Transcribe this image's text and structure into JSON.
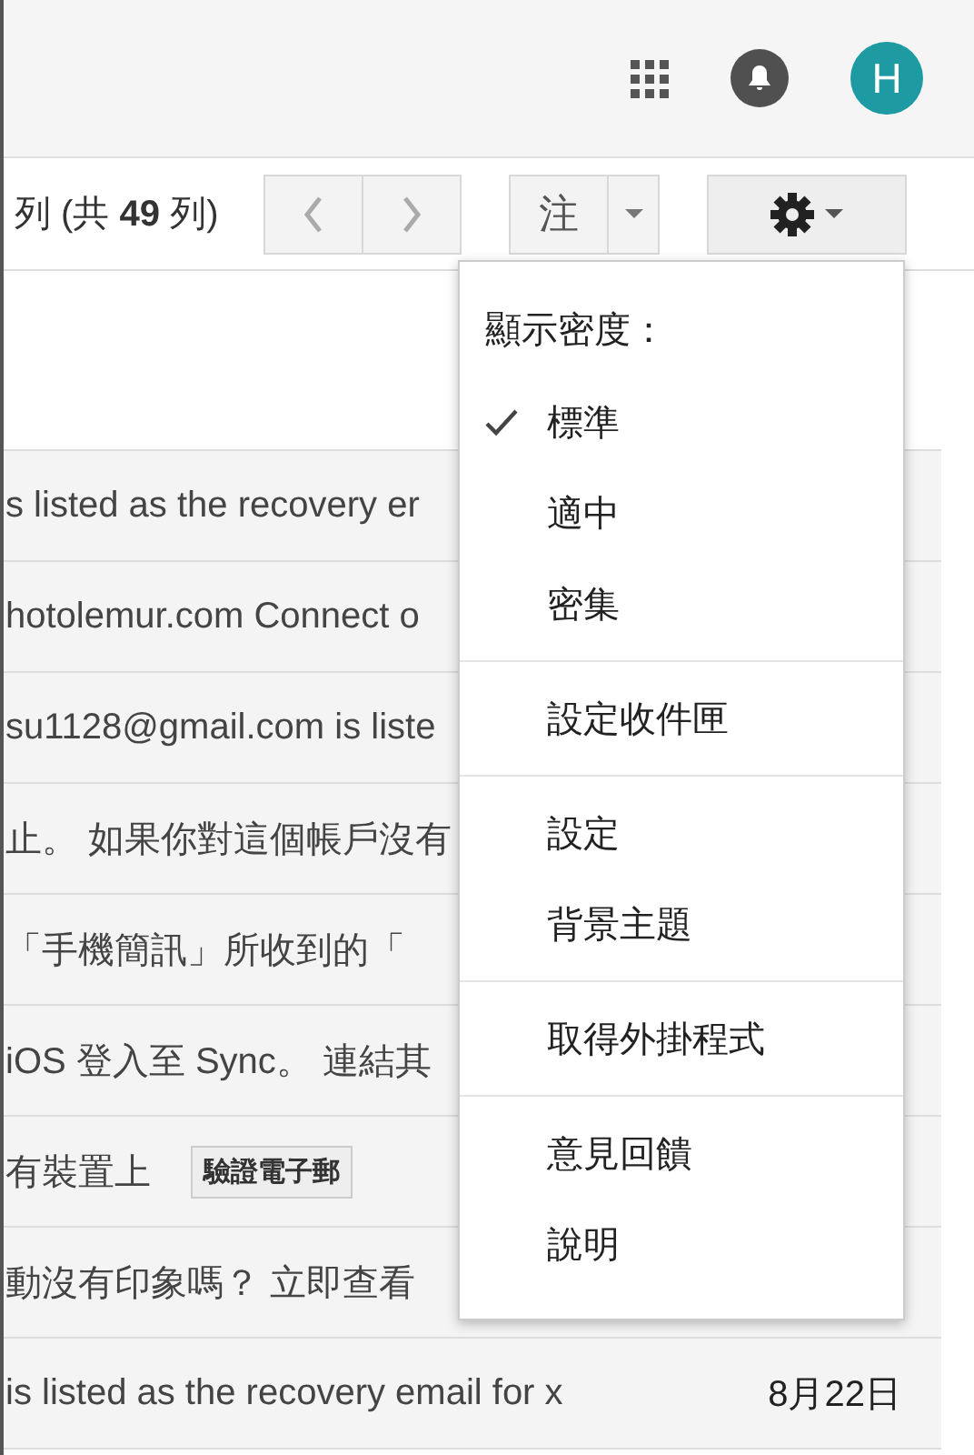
{
  "header": {
    "avatar_letter": "H"
  },
  "toolbar": {
    "range_text": "列 (共 **49** 列)",
    "language_button": "注"
  },
  "messages": [
    {
      "text": "s listed as the recovery er"
    },
    {
      "text": "hotolemur.com Connect o"
    },
    {
      "text": "su1128@gmail.com is liste"
    },
    {
      "text": "止。 如果你對這個帳戶沒有"
    },
    {
      "text": "「手機簡訊」所收到的「"
    },
    {
      "text": "iOS 登入至 Sync。 連結其"
    },
    {
      "text": "有裝置上",
      "button": "驗證電子郵"
    },
    {
      "text": "動沒有印象嗎？ 立即查看"
    },
    {
      "text": "is listed as the recovery email for x",
      "date": "8月22日"
    }
  ],
  "settings_menu": {
    "sections": [
      {
        "header": "顯示密度：",
        "items": [
          {
            "label": "標準",
            "checked": true
          },
          {
            "label": "適中",
            "checked": false
          },
          {
            "label": "密集",
            "checked": false
          }
        ]
      },
      {
        "items": [
          {
            "label": "設定收件匣"
          }
        ]
      },
      {
        "items": [
          {
            "label": "設定"
          },
          {
            "label": "背景主題"
          }
        ]
      },
      {
        "items": [
          {
            "label": "取得外掛程式"
          }
        ]
      },
      {
        "items": [
          {
            "label": "意見回饋"
          },
          {
            "label": "說明"
          }
        ]
      }
    ]
  }
}
